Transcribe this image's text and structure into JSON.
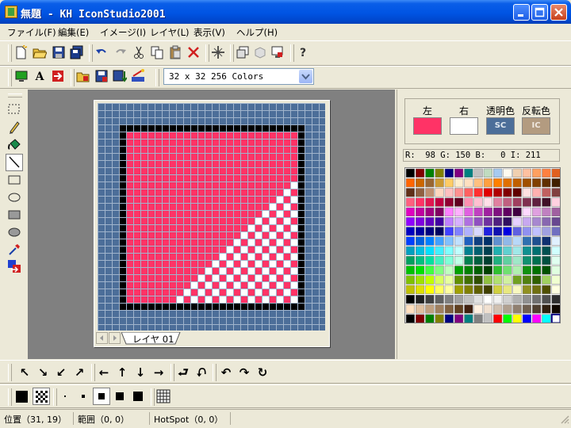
{
  "window": {
    "title": "無題 - KH IconStudio2001",
    "buttons": [
      "minimize",
      "maximize",
      "close"
    ]
  },
  "menu": {
    "items": [
      "ファイル(F)",
      "編集(E)",
      "イメージ(I)",
      "レイヤ(L)",
      "表示(V)",
      "ヘルプ(H)"
    ]
  },
  "toolbar_main": {
    "icons": [
      "new-file-icon",
      "open-folder-icon",
      "save-icon",
      "save-all-icon",
      "undo-icon",
      "redo-icon",
      "cut-icon",
      "copy-icon",
      "paste-icon",
      "delete-icon",
      "selection-icon",
      "duplicate-icon",
      "cube-icon",
      "monitor-icon",
      "help-icon"
    ]
  },
  "toolbar_format": {
    "icons": [
      "monitor-green-icon",
      "text-a-icon",
      "import-icon",
      "open-resource-icon",
      "save-resource-icon",
      "save-down-icon",
      "wand-icon"
    ],
    "format_value": "32 x 32 256 Colors"
  },
  "tools": [
    "rect-select-icon",
    "pencil-icon",
    "fill-bucket-icon",
    "line-icon",
    "rectangle-icon",
    "ellipse-icon",
    "filled-rect-icon",
    "filled-ellipse-icon",
    "eyedropper-icon",
    "replace-color-icon"
  ],
  "canvas": {
    "layer_tab": "レイヤ 01",
    "size": 32,
    "border_color": "#000000",
    "fill_color": "#FF3366",
    "transparent_light": "#FFFFFF",
    "transparent_dark": "#FF3366",
    "outer_color": "#4C6E99"
  },
  "colors": {
    "left_label": "左",
    "right_label": "右",
    "transparent_label": "透明色",
    "invert_label": "反転色",
    "left_color": "#FF3366",
    "right_color": "#FFFFFF",
    "transparent_badge": "SC",
    "invert_badge": "IC",
    "transparent_badge_color": "#4C6E99",
    "invert_badge_color": "#B39B80"
  },
  "rgb_readout": "R:  98 G: 150 B:   0 I: 211",
  "palette": {
    "rows": 16,
    "cols": 16,
    "selected_index": 255
  },
  "bottom_toolbar_1": {
    "icons": [
      "arrow-up-left-icon",
      "arrow-down-right-icon",
      "arrow-down-left-icon",
      "arrow-up-right-icon",
      "arrow-left-icon",
      "arrow-up-icon",
      "arrow-down-icon",
      "arrow-right-icon",
      "flip-horizontal-icon",
      "flip-vertical-icon",
      "rotate-left-icon",
      "rotate-right-icon",
      "rotate-180-icon"
    ]
  },
  "bottom_toolbar_2": {
    "icons": [
      "solid-black-icon",
      "checker-icon",
      "brush-size-1-icon",
      "brush-size-2-icon",
      "brush-size-3-icon",
      "brush-size-4-icon",
      "brush-size-5-icon",
      "grid-toggle-icon"
    ]
  },
  "status": {
    "position": "位置（31, 19）",
    "range": "範囲（0, 0）",
    "hotspot": "HotSpot（0, 0）"
  }
}
